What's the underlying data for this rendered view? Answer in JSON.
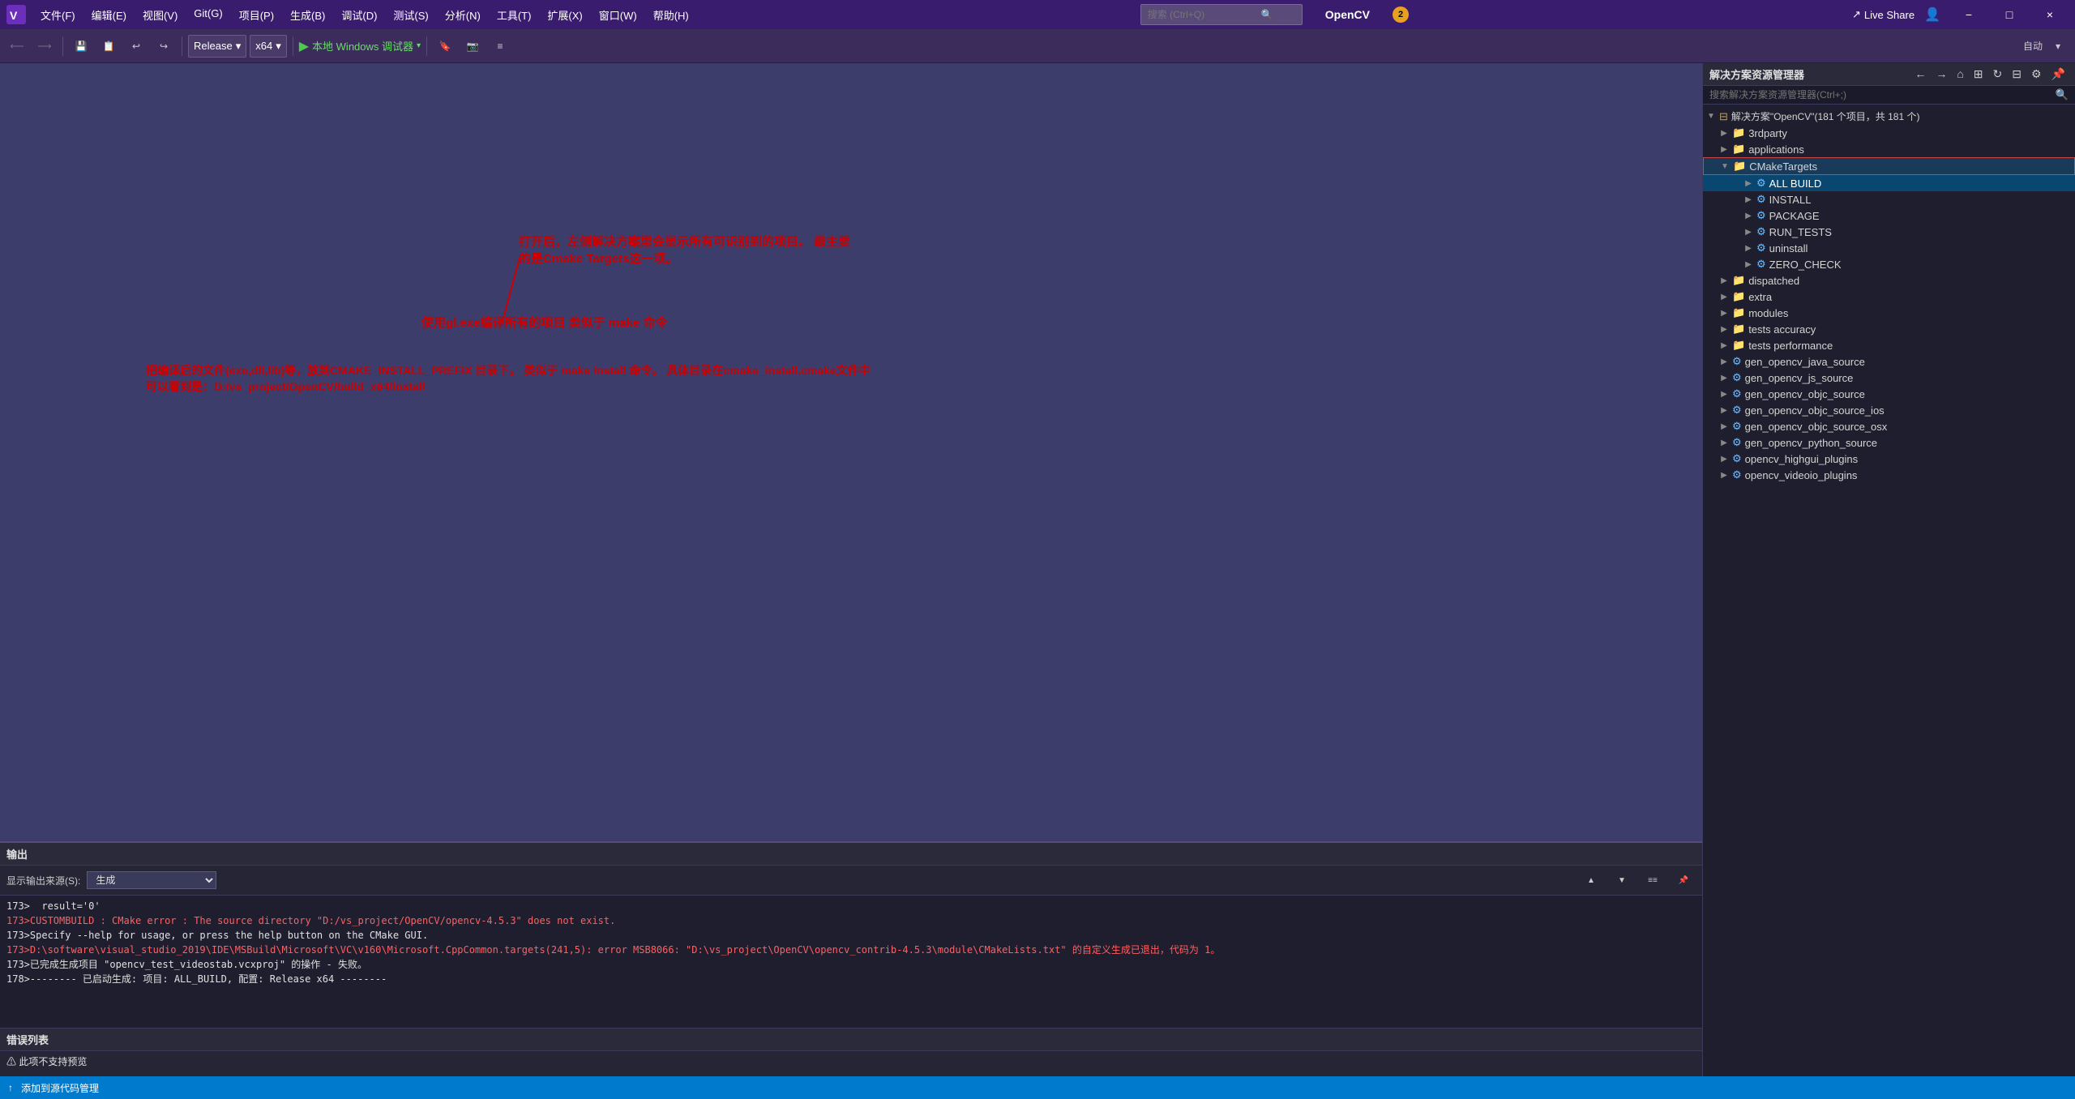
{
  "titlebar": {
    "menus": [
      "文件(F)",
      "编辑(E)",
      "视图(V)",
      "Git(G)",
      "项目(P)",
      "生成(B)",
      "调试(D)",
      "测试(S)",
      "分析(N)",
      "工具(T)",
      "扩展(X)",
      "窗口(W)",
      "帮助(H)"
    ],
    "search_placeholder": "搜索 (Ctrl+Q)",
    "app_name": "OpenCV",
    "notification_count": "2",
    "live_share": "Live Share",
    "window_controls": [
      "−",
      "□",
      "×"
    ]
  },
  "toolbar": {
    "release_label": "Release",
    "platform_label": "x64",
    "run_label": "本地 Windows 调试器",
    "auto_label": "自动"
  },
  "solution_explorer": {
    "title": "解决方案资源管理器",
    "search_placeholder": "搜索解决方案资源管理器(Ctrl+;)",
    "solution_label": "解决方案\"OpenCV\"(181 个项目，共 181 个)",
    "tree_items": [
      {
        "level": 0,
        "icon": "folder",
        "label": "3rdparty",
        "expanded": false
      },
      {
        "level": 0,
        "icon": "folder",
        "label": "applications",
        "expanded": false
      },
      {
        "level": 0,
        "icon": "folder",
        "label": "CMakeTargets",
        "expanded": true,
        "selected": true,
        "highlighted": true
      },
      {
        "level": 1,
        "icon": "build",
        "label": "ALL BUILD",
        "expanded": false
      },
      {
        "level": 1,
        "icon": "build",
        "label": "INSTALL",
        "expanded": false
      },
      {
        "level": 1,
        "icon": "build",
        "label": "PACKAGE",
        "expanded": false
      },
      {
        "level": 1,
        "icon": "build",
        "label": "RUN_TESTS",
        "expanded": false
      },
      {
        "level": 1,
        "icon": "build",
        "label": "uninstall",
        "expanded": false
      },
      {
        "level": 1,
        "icon": "build",
        "label": "ZERO_CHECK",
        "expanded": false
      },
      {
        "level": 0,
        "icon": "folder",
        "label": "dispatched",
        "expanded": false
      },
      {
        "level": 0,
        "icon": "folder",
        "label": "extra",
        "expanded": false
      },
      {
        "level": 0,
        "icon": "folder",
        "label": "modules",
        "expanded": false
      },
      {
        "level": 0,
        "icon": "folder",
        "label": "tests accuracy",
        "expanded": false
      },
      {
        "level": 0,
        "icon": "folder",
        "label": "tests performance",
        "expanded": false
      },
      {
        "level": 0,
        "icon": "build",
        "label": "gen_opencv_java_source",
        "expanded": false
      },
      {
        "level": 0,
        "icon": "build",
        "label": "gen_opencv_js_source",
        "expanded": false
      },
      {
        "level": 0,
        "icon": "build",
        "label": "gen_opencv_objc_source",
        "expanded": false
      },
      {
        "level": 0,
        "icon": "build",
        "label": "gen_opencv_objc_source_ios",
        "expanded": false
      },
      {
        "level": 0,
        "icon": "build",
        "label": "gen_opencv_objc_source_osx",
        "expanded": false
      },
      {
        "level": 0,
        "icon": "build",
        "label": "gen_opencv_python_source",
        "expanded": false
      },
      {
        "level": 0,
        "icon": "build",
        "label": "opencv_highgui_plugins",
        "expanded": false
      },
      {
        "level": 0,
        "icon": "build",
        "label": "opencv_videoio_plugins",
        "expanded": false
      }
    ]
  },
  "annotations": {
    "annotation1": "打开后，左侧解决方案里会显示所有可识别到的项目。\n最主要的是Cmake Targets这一项。",
    "annotation2": "使用gl.exe编译所有的项目\n类似于 make 命令",
    "annotation3": "把编译后的文件(exe,dll,lib)等，放到CMAKE_INSTALL_PREFIX 目录下。\n类似于 make install 命令。\n具体目录在cmake_install.cmake文件中可以看到是：D:/vs_project/OpenCV/build_x64/install"
  },
  "output": {
    "title": "输出",
    "source_label": "显示输出来源(S):",
    "source_value": "生成",
    "lines": [
      {
        "text": "173>  result='0'",
        "type": "normal"
      },
      {
        "text": "173>CUSTOMBUILD : CMake error : The source directory \"D:/vs_project/OpenCV/opencv-4.5.3\" does not exist.",
        "type": "error"
      },
      {
        "text": "173>Specify --help for usage, or press the help button on the CMake GUI.",
        "type": "normal"
      },
      {
        "text": "173>D:\\software\\visual_studio_2019\\IDE\\MSBuild\\Microsoft\\VC\\v160\\Microsoft.CppCommon.targets(241,5): error MSB8066: \"D:\\vs_project\\OpenCV\\opencv_contrib-4.5.3\\module\\CMakeLists.txt\" 的自定义生成已退出，代码为 1。",
        "type": "error"
      },
      {
        "text": "173>已完成生成项目 \"opencv_test_videostab.vcxproj\" 的操作 - 失败。",
        "type": "normal"
      },
      {
        "text": "178>-------- 已启动生成: 项目: ALL_BUILD, 配置: Release x64 --------",
        "type": "normal"
      }
    ]
  },
  "error_list": {
    "title": "错误列表",
    "message": "⚠ 此项不支持预览"
  },
  "status_bar": {
    "left": "添加到源代码管理",
    "right": ""
  }
}
